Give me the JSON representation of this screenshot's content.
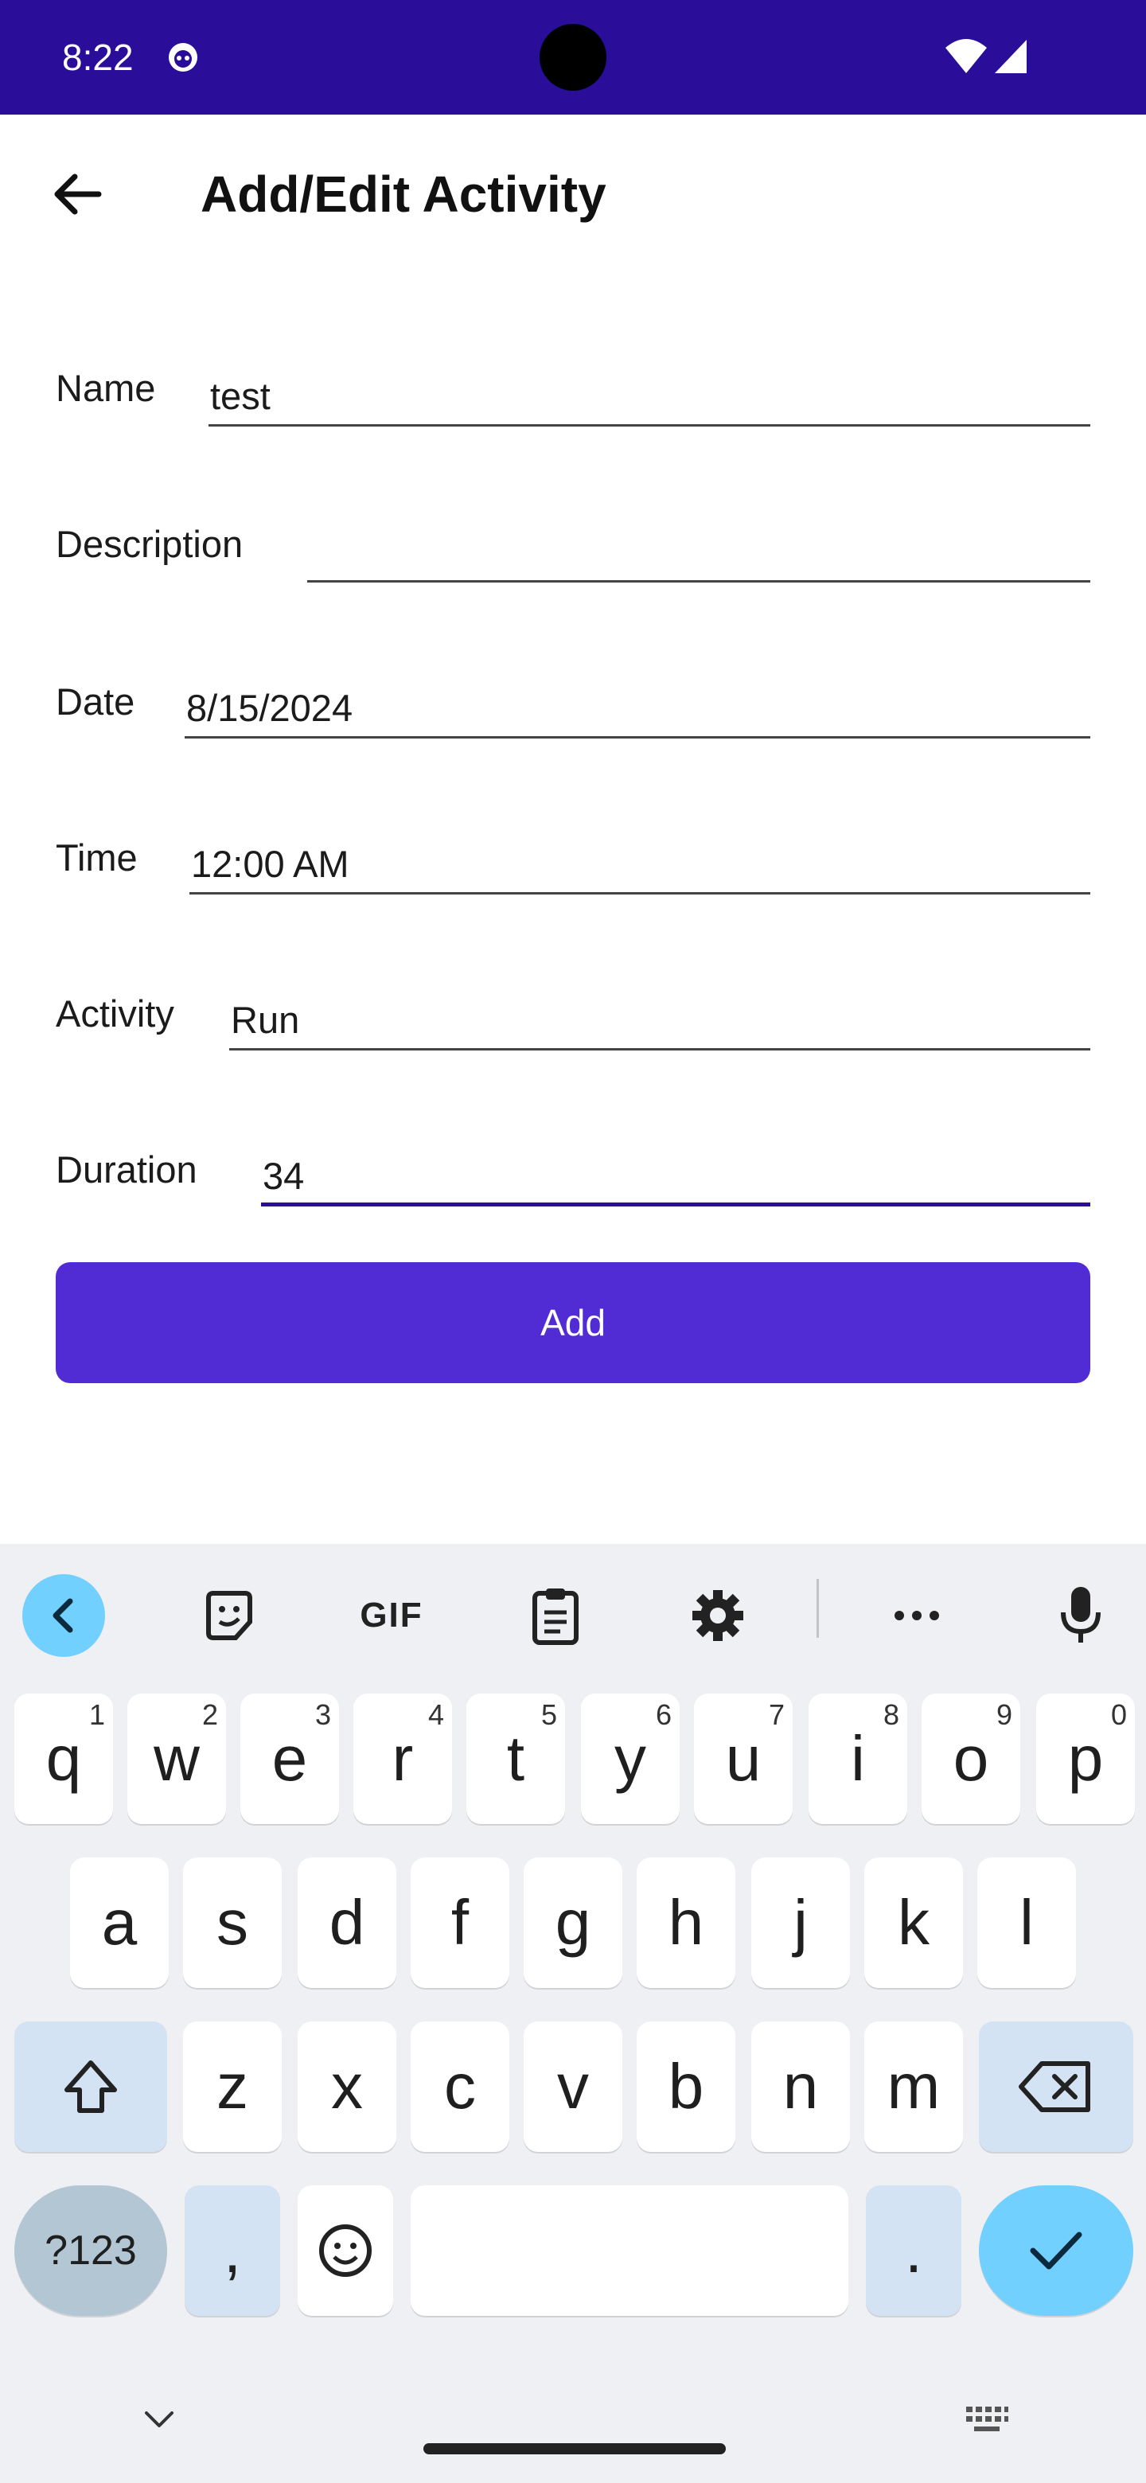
{
  "status_bar": {
    "time": "8:22"
  },
  "app_bar": {
    "title": "Add/Edit Activity"
  },
  "form": {
    "name_label": "Name",
    "name_value": "test",
    "description_label": "Description",
    "description_value": "",
    "date_label": "Date",
    "date_value": "8/15/2024",
    "time_label": "Time",
    "time_value": "12:00 AM",
    "activity_label": "Activity",
    "activity_value": "Run",
    "duration_label": "Duration",
    "duration_value": "34",
    "add_label": "Add"
  },
  "keyboard": {
    "toolbar": {
      "gif_label": "GIF"
    },
    "row1": [
      {
        "k": "q",
        "n": "1"
      },
      {
        "k": "w",
        "n": "2"
      },
      {
        "k": "e",
        "n": "3"
      },
      {
        "k": "r",
        "n": "4"
      },
      {
        "k": "t",
        "n": "5"
      },
      {
        "k": "y",
        "n": "6"
      },
      {
        "k": "u",
        "n": "7"
      },
      {
        "k": "i",
        "n": "8"
      },
      {
        "k": "o",
        "n": "9"
      },
      {
        "k": "p",
        "n": "0"
      }
    ],
    "row2": [
      "a",
      "s",
      "d",
      "f",
      "g",
      "h",
      "j",
      "k",
      "l"
    ],
    "row3": [
      "z",
      "x",
      "c",
      "v",
      "b",
      "n",
      "m"
    ],
    "symbols_label": "?123",
    "comma_label": ",",
    "period_label": "."
  },
  "colors": {
    "status_bar": "#2a0d99",
    "accent": "#512bd4",
    "focus_underline": "#2a0d99",
    "keyboard_bg": "#eff0f4"
  },
  "icons": [
    "back-arrow-icon",
    "wifi-icon",
    "signal-icon",
    "sticker-icon",
    "clipboard-icon",
    "gear-icon",
    "more-icon",
    "mic-icon",
    "backspace-icon",
    "shift-icon",
    "emoji-icon",
    "check-icon",
    "chevron-down-icon",
    "keyboard-icon"
  ]
}
